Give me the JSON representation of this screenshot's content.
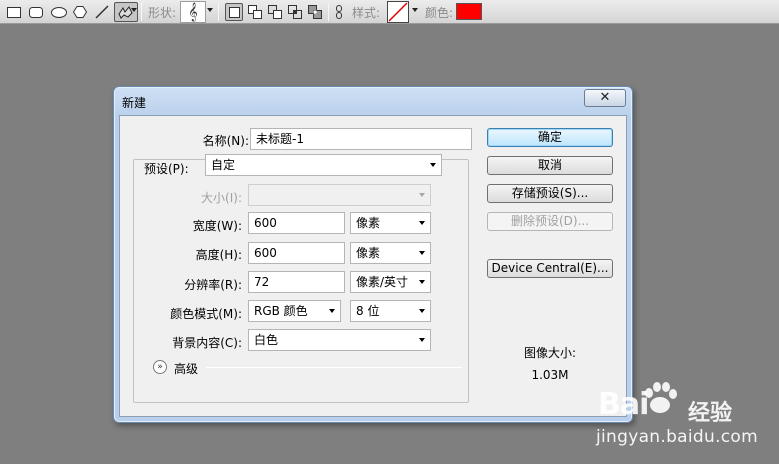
{
  "toolbar": {
    "icons": [
      "rectangle-tool",
      "rounded-rectangle-tool",
      "ellipse-tool",
      "polygon-tool",
      "line-tool",
      "custom-shape-tool"
    ],
    "shape_label": "形状:",
    "shape_glyph": "𝄞",
    "style_label": "样式:",
    "color_label": "颜色:",
    "color_value": "#ff0000"
  },
  "dialog": {
    "title": "新建",
    "close_label": "✕",
    "name": {
      "label": "名称(N):",
      "value": "未标题-1"
    },
    "preset": {
      "label": "预设(P):",
      "value": "自定"
    },
    "size": {
      "label": "大小(I):",
      "value": ""
    },
    "width": {
      "label": "宽度(W):",
      "value": "600",
      "unit": "像素"
    },
    "height": {
      "label": "高度(H):",
      "value": "600",
      "unit": "像素"
    },
    "resolution": {
      "label": "分辨率(R):",
      "value": "72",
      "unit": "像素/英寸"
    },
    "color_mode": {
      "label": "颜色模式(M):",
      "value": "RGB 颜色",
      "depth": "8 位"
    },
    "background": {
      "label": "背景内容(C):",
      "value": "白色"
    },
    "advanced_label": "高级",
    "buttons": {
      "ok": "确定",
      "cancel": "取消",
      "save_preset": "存储预设(S)...",
      "delete_preset": "删除预设(D)...",
      "device_central": "Device Central(E)..."
    },
    "image_size_label": "图像大小:",
    "image_size_value": "1.03M"
  },
  "watermark": {
    "logo_text": "Bai",
    "logo_text2": "经验",
    "url": "jingyan.baidu.com"
  }
}
